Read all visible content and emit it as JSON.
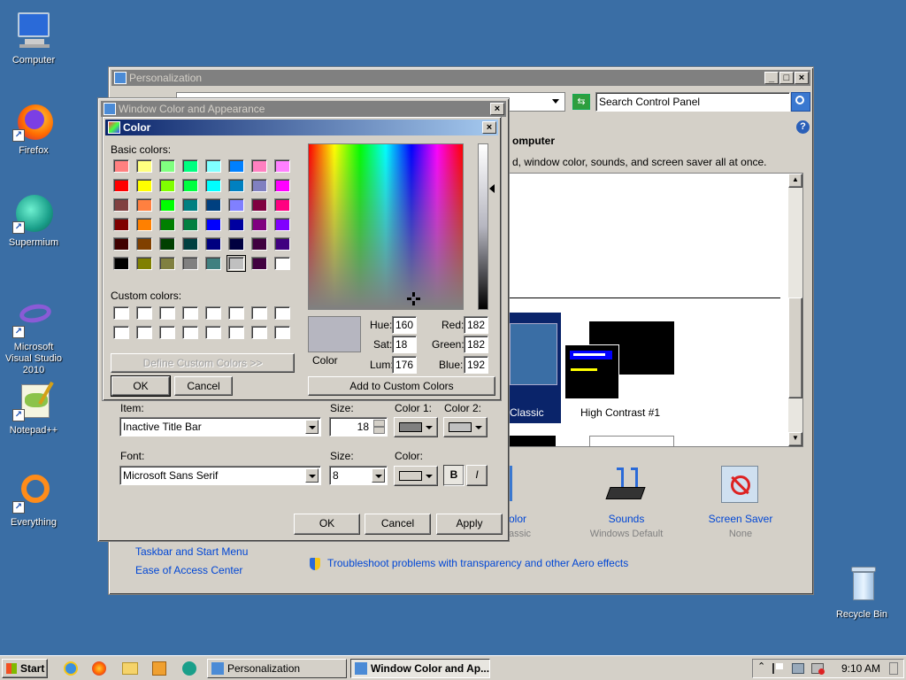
{
  "desktop": {
    "icons": [
      {
        "label": "Computer"
      },
      {
        "label": "Firefox"
      },
      {
        "label": "Supermium"
      },
      {
        "label": "Microsoft Visual Studio 2010"
      },
      {
        "label": "Notepad++"
      },
      {
        "label": "Everything"
      },
      {
        "label": "Recycle Bin"
      }
    ]
  },
  "personalization": {
    "title": "Personalization",
    "search_placeholder": "Search Control Panel",
    "heading_fragment": "omputer",
    "desc_fragment": "d, window color, sounds, and screen saver all at once.",
    "themes": [
      {
        "label": "Classic"
      },
      {
        "label": "High Contrast #1"
      }
    ],
    "bottom_items": [
      {
        "title": "olor",
        "sub": "assic"
      },
      {
        "title": "Sounds",
        "sub": "Windows Default"
      },
      {
        "title": "Screen Saver",
        "sub": "None"
      }
    ],
    "links": {
      "taskbar": "Taskbar and Start Menu",
      "ease": "Ease of Access Center",
      "troubleshoot": "Troubleshoot problems with transparency and other Aero effects"
    }
  },
  "wca": {
    "title": "Window Color and Appearance",
    "item_label": "Item:",
    "item_value": "Inactive Title Bar",
    "size_label": "Size:",
    "size_value": "18",
    "color1_label": "Color 1:",
    "color2_label": "Color 2:",
    "font_label": "Font:",
    "font_value": "Microsoft Sans Serif",
    "font_size_label": "Size:",
    "font_size_value": "8",
    "font_color_label": "Color:",
    "bold_label": "B",
    "italic_label": "I",
    "ok": "OK",
    "cancel": "Cancel",
    "apply": "Apply"
  },
  "color_dialog": {
    "title": "Color",
    "basic_label": "Basic colors:",
    "custom_label": "Custom colors:",
    "define_custom": "Define Custom Colors >>",
    "ok": "OK",
    "cancel": "Cancel",
    "add_custom": "Add to Custom Colors",
    "color_label": "Color",
    "hue_label": "Hue:",
    "hue": "160",
    "sat_label": "Sat:",
    "sat": "18",
    "lum_label": "Lum:",
    "lum": "176",
    "red_label": "Red:",
    "red": "182",
    "green_label": "Green:",
    "green": "182",
    "blue_label": "Blue:",
    "blue": "192",
    "basic_colors": [
      "#ff8080",
      "#ffff80",
      "#80ff80",
      "#00ff80",
      "#80ffff",
      "#0080ff",
      "#ff80c0",
      "#ff80ff",
      "#ff0000",
      "#ffff00",
      "#80ff00",
      "#00ff40",
      "#00ffff",
      "#0080c0",
      "#8080c0",
      "#ff00ff",
      "#804040",
      "#ff8040",
      "#00ff00",
      "#008080",
      "#004080",
      "#8080ff",
      "#800040",
      "#ff0080",
      "#800000",
      "#ff8000",
      "#008000",
      "#008040",
      "#0000ff",
      "#0000a0",
      "#800080",
      "#8000ff",
      "#400000",
      "#804000",
      "#004000",
      "#004040",
      "#000080",
      "#000040",
      "#400040",
      "#400080",
      "#000000",
      "#808000",
      "#808040",
      "#808080",
      "#408080",
      "#c0c0c0",
      "#400040",
      "#ffffff"
    ],
    "selected_index": 45,
    "current_color": "#b6b6c0"
  },
  "taskbar": {
    "start": "Start",
    "tasks": [
      {
        "label": "Personalization"
      },
      {
        "label": "Window Color and Ap..."
      }
    ],
    "clock": "9:10 AM"
  }
}
